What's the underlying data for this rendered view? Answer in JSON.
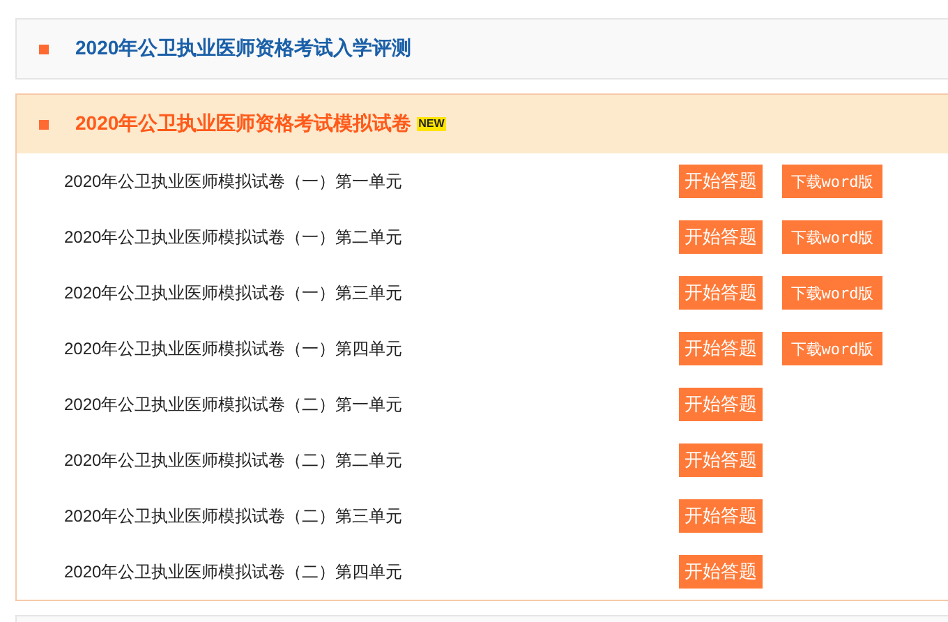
{
  "sections": [
    {
      "title": "2020年公卫执业医师资格考试入学评测",
      "expanded": false
    },
    {
      "title": "2020年公卫执业医师资格考试模拟试卷",
      "badge": "NEW",
      "expanded": true,
      "items": [
        {
          "title": "2020年公卫执业医师模拟试卷（一）第一单元",
          "buttons": [
            "开始答题",
            "下载word版"
          ]
        },
        {
          "title": "2020年公卫执业医师模拟试卷（一）第二单元",
          "buttons": [
            "开始答题",
            "下载word版"
          ]
        },
        {
          "title": "2020年公卫执业医师模拟试卷（一）第三单元",
          "buttons": [
            "开始答题",
            "下载word版"
          ]
        },
        {
          "title": "2020年公卫执业医师模拟试卷（一）第四单元",
          "buttons": [
            "开始答题",
            "下载word版"
          ]
        },
        {
          "title": "2020年公卫执业医师模拟试卷（二）第一单元",
          "buttons": [
            "开始答题"
          ]
        },
        {
          "title": "2020年公卫执业医师模拟试卷（二）第二单元",
          "buttons": [
            "开始答题"
          ]
        },
        {
          "title": "2020年公卫执业医师模拟试卷（二）第三单元",
          "buttons": [
            "开始答题"
          ]
        },
        {
          "title": "2020年公卫执业医师模拟试卷（二）第四单元",
          "buttons": [
            "开始答题"
          ]
        }
      ]
    }
  ]
}
